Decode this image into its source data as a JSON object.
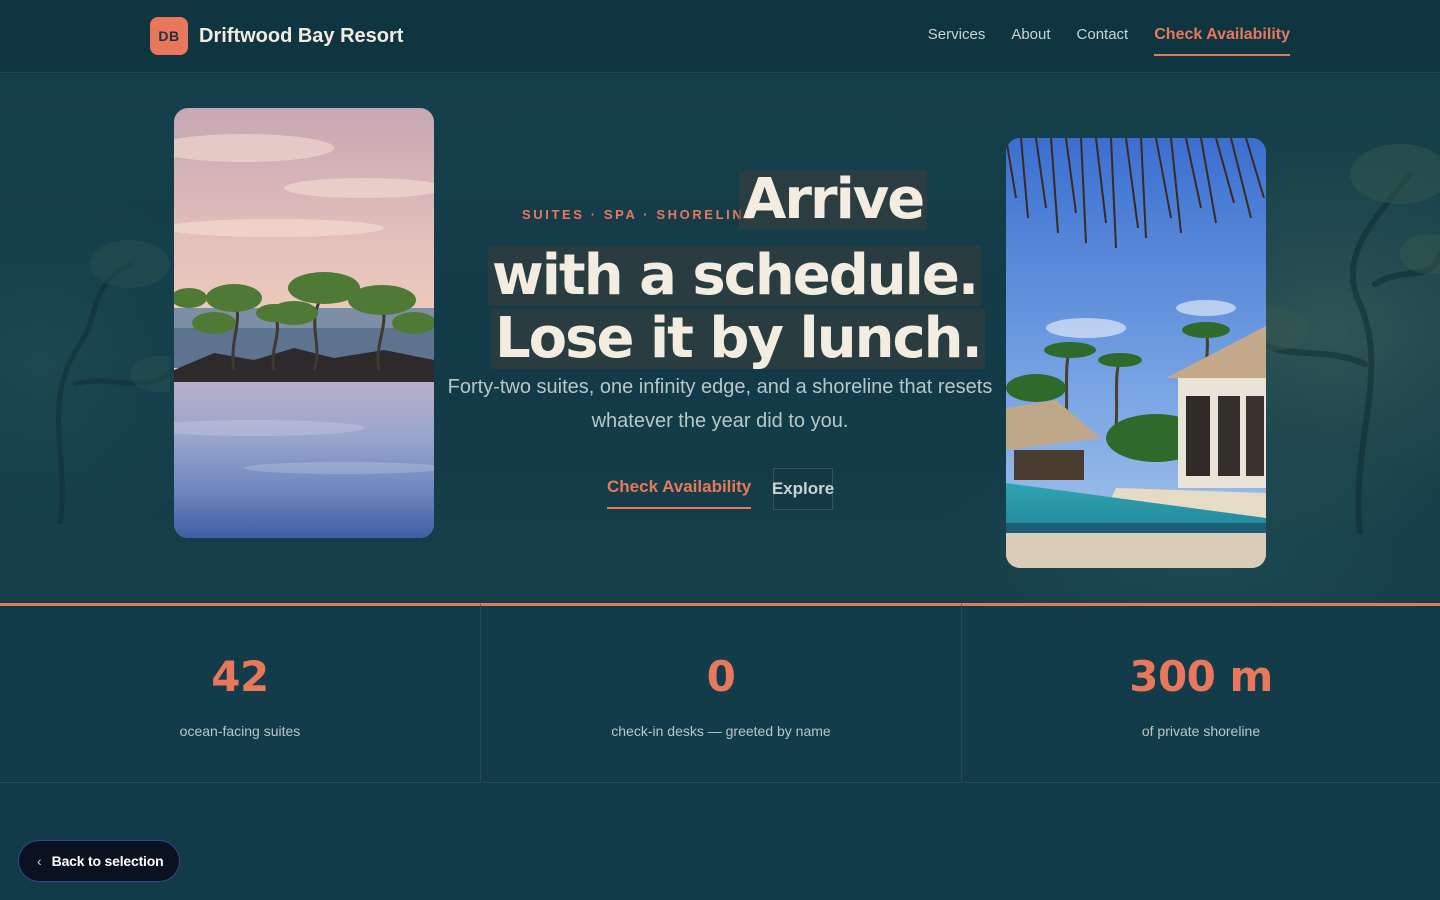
{
  "header": {
    "logo_initials": "DB",
    "brand_name": "Driftwood Bay Resort",
    "nav": [
      {
        "label": "Services"
      },
      {
        "label": "About"
      },
      {
        "label": "Contact"
      }
    ],
    "cta_label": "Check Availability"
  },
  "hero": {
    "eyebrow": "SUITES · SPA · SHORELINE",
    "headline": [
      "Arrive",
      "with a schedule.",
      "Lose it by lunch."
    ],
    "subtitle": "Forty-two suites, one infinity edge, and a shoreline that resets whatever the year did to you.",
    "primary_button": "Check Availability",
    "secondary_button": "Explore",
    "left_image_icon": "sunset-infinity-pool-image",
    "right_image_icon": "thatched-villa-pool-image"
  },
  "stats": [
    {
      "value": "42",
      "label": "ocean-facing suites"
    },
    {
      "value": "0",
      "label": "check-in desks — greeted by name"
    },
    {
      "value": "300 m",
      "label": "of private shoreline"
    }
  ],
  "footer": {
    "back_label": "Back to selection",
    "back_icon": "chevron-left-icon"
  },
  "colors": {
    "background": "#113b48",
    "accent": "#e9775b",
    "text": "#f3ece0",
    "muted": "#b9c6c9"
  }
}
